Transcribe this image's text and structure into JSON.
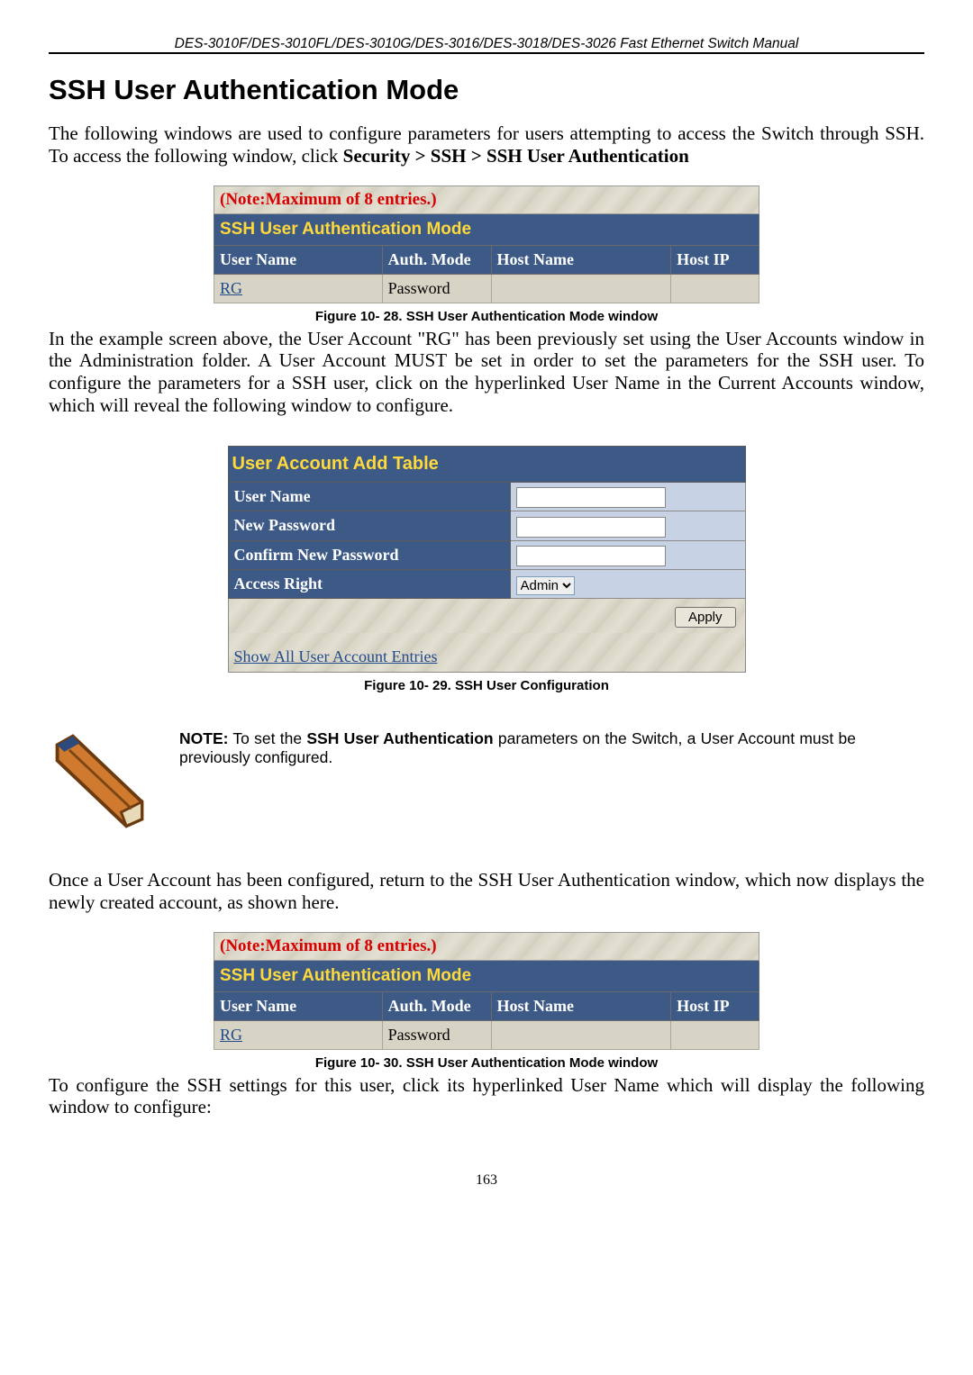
{
  "header": "DES-3010F/DES-3010FL/DES-3010G/DES-3016/DES-3018/DES-3026 Fast Ethernet Switch Manual",
  "section_title": "SSH User Authentication Mode",
  "intro_text_1": "The following windows are used to configure parameters for users attempting to access the Switch through SSH. To access the following window, click ",
  "intro_bold": "Security > SSH > SSH User Authentication",
  "table1": {
    "note": "(Note:Maximum of 8 entries.)",
    "title": "SSH User Authentication Mode",
    "columns": {
      "c1": "User Name",
      "c2": "Auth. Mode",
      "c3": "Host Name",
      "c4": "Host IP"
    },
    "row": {
      "user": "RG",
      "auth": "Password",
      "host": "",
      "ip": ""
    }
  },
  "caption1": "Figure 10- 28. SSH User Authentication Mode window",
  "para1": "In the example screen above, the User Account \"RG\" has been previously set using the User Accounts window in the Administration folder. A User Account MUST be set in order to set the parameters for the SSH user. To configure the parameters for a SSH user, click on the hyperlinked User Name in the Current Accounts window, which will reveal the following window to configure.",
  "table2": {
    "title": "User Account Add Table",
    "labels": {
      "l1": "User Name",
      "l2": "New Password",
      "l3": "Confirm New Password",
      "l4": "Access Right"
    },
    "access_option": "Admin",
    "apply": "Apply",
    "show_all": "Show All User Account Entries"
  },
  "caption2": "Figure 10- 29. SSH User Configuration",
  "note": {
    "label": "NOTE:",
    "pre": " To set the ",
    "bold": "SSH User Authentication",
    "post": " parameters on the Switch, a User Account must be previously configured."
  },
  "para2": "Once a User Account has been configured, return to the SSH User Authentication window, which now displays the newly created account, as shown here.",
  "caption3": "Figure 10- 30. SSH User Authentication Mode window",
  "para3": "To configure the SSH settings for this user, click its hyperlinked User Name which will display the following window to configure:",
  "page_num": "163"
}
